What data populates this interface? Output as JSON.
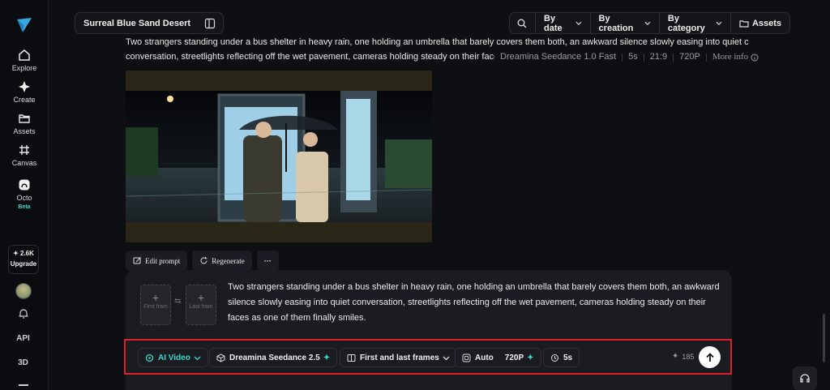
{
  "sidebar": {
    "items": [
      {
        "label": "Explore",
        "icon": "home-icon"
      },
      {
        "label": "Create",
        "icon": "sparkle-icon"
      },
      {
        "label": "Assets",
        "icon": "folder-icon"
      },
      {
        "label": "Canvas",
        "icon": "canvas-icon"
      },
      {
        "label": "Octo",
        "icon": "octo-icon",
        "badge": "Beta"
      }
    ],
    "upgrade_credits": "✦ 2.6K",
    "upgrade_label": "Upgrade",
    "api_label": "API",
    "three_d_label": "3D"
  },
  "header": {
    "project_title": "Surreal Blue Sand Desert",
    "filters": [
      "By date",
      "By creation",
      "By category"
    ],
    "assets_label": "Assets"
  },
  "generation": {
    "prompt_line1": "Two strangers standing under a bus shelter in heavy rain, one holding an umbrella that barely covers them both, an awkward silence slowly easing into quiet c",
    "prompt_line2": "conversation, streetlights reflecting off the wet pavement, cameras holding steady on their faces as one of them finally smiles.",
    "model": "Dreamina Seedance 1.0 Fast",
    "duration": "5s",
    "ratio": "21:9",
    "resolution": "720P",
    "more_info": "More info",
    "edit_prompt": "Edit prompt",
    "regenerate": "Regenerate",
    "more": "···"
  },
  "composer": {
    "first_frame": "First fram",
    "last_frame": "Last fram",
    "text": "Two strangers standing under a bus shelter in heavy rain, one holding an umbrella that barely covers them both, an awkward silence slowly easing into quiet conversation, streetlights reflecting off the wet pavement, cameras holding steady on their faces as one of them finally smiles.",
    "mode": "AI Video",
    "model": "Dreamina Seedance 2.5",
    "frames_mode": "First and last frames",
    "ratio": "Auto",
    "resolution": "720P",
    "duration": "5s",
    "credits": "185"
  },
  "colors": {
    "accent": "#3ad6c9",
    "highlight": "#d9222a"
  }
}
